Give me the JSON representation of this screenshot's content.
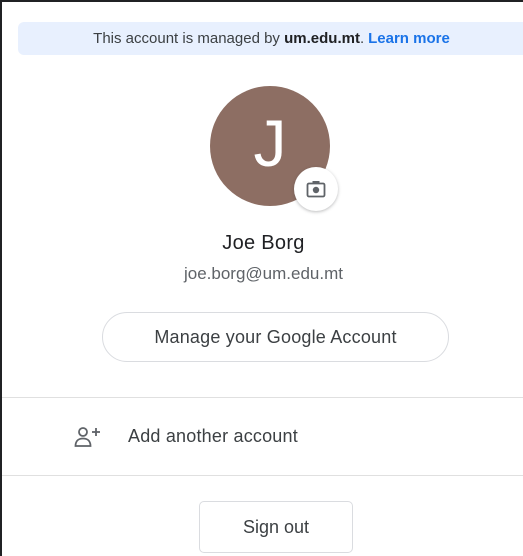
{
  "notice": {
    "prefix": "This account is managed by",
    "domain": "um.edu.mt",
    "suffix": ".",
    "link": "Learn more"
  },
  "profile": {
    "initial": "J",
    "avatar_color": "#8d6e63",
    "name": "Joe Borg",
    "email": "joe.borg@um.edu.mt",
    "camera_icon": "camera-icon"
  },
  "actions": {
    "manage_label": "Manage your Google Account",
    "add_account_label": "Add another account",
    "add_account_icon": "person-add-icon",
    "sign_out_label": "Sign out"
  },
  "colors": {
    "link": "#1a73e8",
    "notice_bg": "#e8f0fe",
    "text_primary": "#202124",
    "text_secondary": "#5f6368",
    "border": "#dadce0"
  }
}
